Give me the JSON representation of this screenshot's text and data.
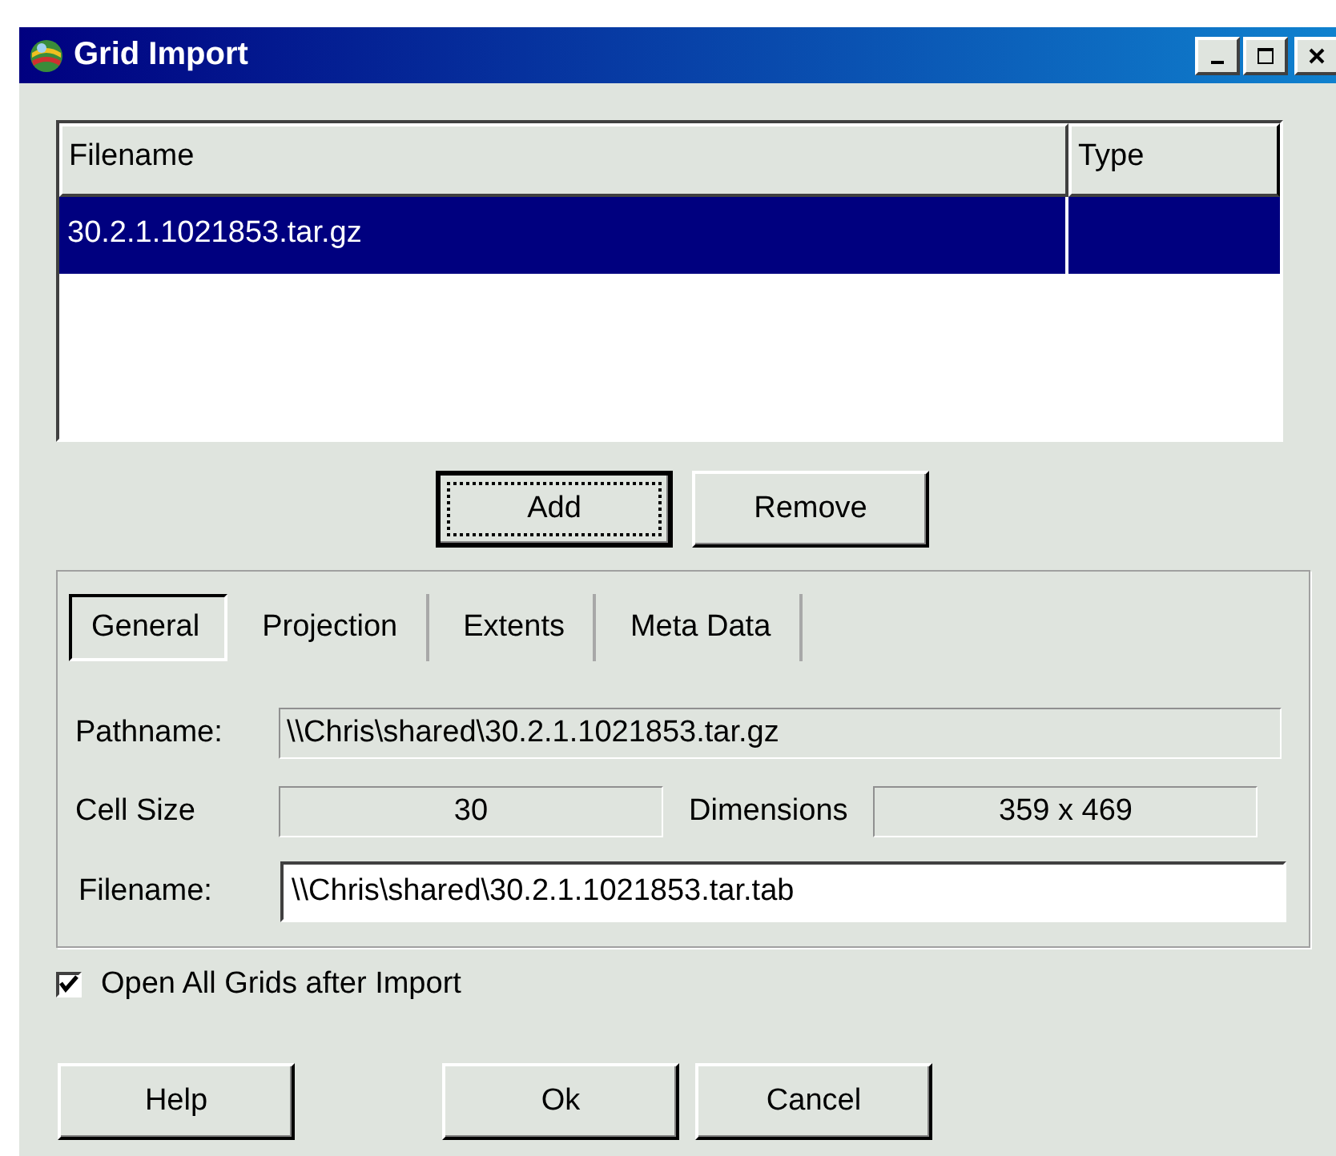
{
  "window": {
    "title": "Grid Import"
  },
  "file_list": {
    "columns": [
      "Filename",
      "Type"
    ],
    "rows": [
      {
        "cells": [
          "30.2.1.1021853.tar.gz",
          ""
        ],
        "selected": true
      }
    ]
  },
  "list_buttons": [
    {
      "label": "Add",
      "focused": true
    },
    {
      "label": "Remove",
      "focused": false
    }
  ],
  "tabs": [
    {
      "label": "General",
      "selected": true
    },
    {
      "label": "Projection",
      "selected": false
    },
    {
      "label": "Extents",
      "selected": false
    },
    {
      "label": "Meta Data",
      "selected": false
    }
  ],
  "general": {
    "pathname": {
      "label": "Pathname:",
      "value": "\\\\Chris\\shared\\30.2.1.1021853.tar.gz"
    },
    "cell_size": {
      "label": "Cell Size",
      "value": "30"
    },
    "dimensions": {
      "label": "Dimensions",
      "value": "359 x 469"
    },
    "filename": {
      "label": "Filename:",
      "value": "\\\\Chris\\shared\\30.2.1.1021853.tar.tab"
    }
  },
  "open_all": {
    "label": "Open All Grids after Import",
    "checked": true
  },
  "buttons": [
    {
      "label": "Help"
    },
    {
      "label": "Ok"
    },
    {
      "label": "Cancel"
    }
  ]
}
